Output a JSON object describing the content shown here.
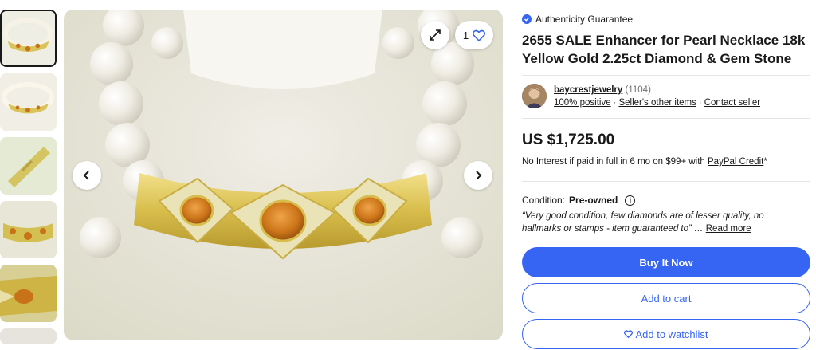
{
  "gallery": {
    "thumbnail_count": 6,
    "watch_count": "1"
  },
  "listing": {
    "authenticity_label": "Authenticity Guarantee",
    "title": "2655 SALE Enhancer for Pearl Necklace 18k Yellow Gold 2.25ct Diamond & Gem Stone",
    "price": "US $1,725.00"
  },
  "seller": {
    "name": "baycrestjewelry",
    "feedback_count": "(1104)",
    "positive": "100% positive",
    "other_items": "Seller's other items",
    "contact": "Contact seller"
  },
  "financing": {
    "text": "No Interest if paid in full in 6 mo on $99+ with ",
    "link": "PayPal Credit",
    "suffix": "*"
  },
  "condition": {
    "label": "Condition:",
    "value": "Pre-owned",
    "quote": "“Very good condition, few diamonds are of lesser quality, no hallmarks or stamps - item guaranteed to”",
    "ellipsis": "…",
    "read_more": "Read more"
  },
  "actions": {
    "buy_now": "Buy It Now",
    "add_to_cart": "Add to cart",
    "add_to_watchlist": "Add to watchlist"
  },
  "colors": {
    "accent": "#3665f3",
    "text": "#191919",
    "muted": "#707070",
    "gold": "#d4b94a",
    "gem": "#c8721a"
  },
  "icons": {
    "authenticity": "verified-check-icon",
    "expand": "expand-icon",
    "heart": "heart-icon",
    "prev": "chevron-left-icon",
    "next": "chevron-right-icon",
    "info": "info-icon"
  }
}
